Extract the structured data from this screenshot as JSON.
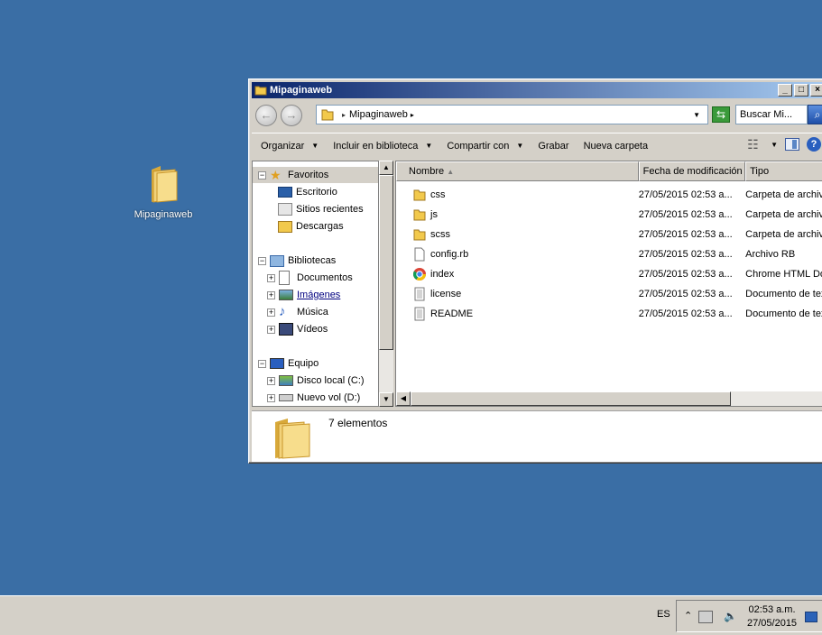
{
  "desktop": {
    "icon_label": "Mipaginaweb"
  },
  "window": {
    "title": "Mipaginaweb",
    "controls": {
      "minimize": "_",
      "maximize": "□",
      "close": "×"
    }
  },
  "address_bar": {
    "path": "Mipaginaweb",
    "search_placeholder": "Buscar Mi..."
  },
  "command_bar": {
    "organize": "Organizar",
    "include_library": "Incluir en biblioteca",
    "share_with": "Compartir con",
    "burn": "Grabar",
    "new_folder": "Nueva carpeta"
  },
  "nav": {
    "favorites": "Favoritos",
    "desktop": "Escritorio",
    "recent": "Sitios recientes",
    "downloads": "Descargas",
    "libraries": "Bibliotecas",
    "documents": "Documentos",
    "images": "Imágenes",
    "music": "Música",
    "videos": "Vídeos",
    "computer": "Equipo",
    "drive_c": "Disco local (C:)",
    "drive_d": "Nuevo vol (D:)"
  },
  "columns": {
    "name": "Nombre",
    "modified": "Fecha de modificación",
    "type": "Tipo"
  },
  "files": [
    {
      "name": "css",
      "date": "27/05/2015 02:53 a...",
      "type": "Carpeta de archivos",
      "icon": "folder-icon"
    },
    {
      "name": "js",
      "date": "27/05/2015 02:53 a...",
      "type": "Carpeta de archivos",
      "icon": "folder-icon"
    },
    {
      "name": "scss",
      "date": "27/05/2015 02:53 a...",
      "type": "Carpeta de archivos",
      "icon": "folder-icon"
    },
    {
      "name": "config.rb",
      "date": "27/05/2015 02:53 a...",
      "type": "Archivo RB",
      "icon": "file-icon"
    },
    {
      "name": "index",
      "date": "27/05/2015 02:53 a...",
      "type": "Chrome HTML Document",
      "icon": "chrome-icon"
    },
    {
      "name": "license",
      "date": "27/05/2015 02:53 a...",
      "type": "Documento de texto",
      "icon": "text-file-icon"
    },
    {
      "name": "README",
      "date": "27/05/2015 02:53 a...",
      "type": "Documento de texto",
      "icon": "text-file-icon"
    }
  ],
  "details": {
    "count": "7 elementos"
  },
  "taskbar": {
    "language": "ES",
    "time": "02:53 a.m.",
    "date": "27/05/2015"
  }
}
